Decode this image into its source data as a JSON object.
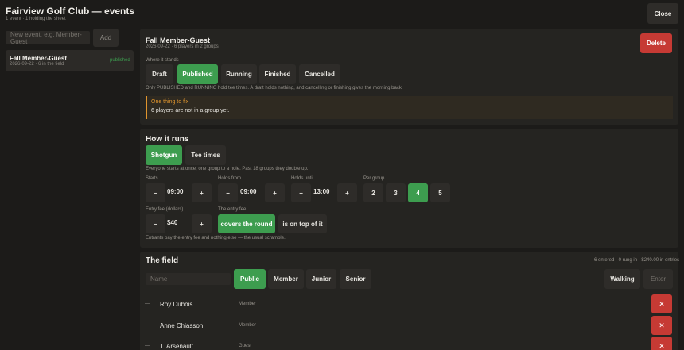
{
  "header": {
    "title": "Fairview Golf Club — events",
    "subtitle": "1 event · 1 holding the sheet",
    "close_label": "Close"
  },
  "sidebar": {
    "new_event_placeholder": "New event, e.g. Member-Guest",
    "add_label": "Add",
    "events": [
      {
        "name": "Fall Member-Guest",
        "meta": "2026-09-22 · 6 in the field",
        "status": "published"
      }
    ]
  },
  "event": {
    "name": "Fall Member-Guest",
    "meta": "2026-09-22 · 6 players in 2 groups",
    "delete_label": "Delete",
    "stands_label": "Where it stands",
    "states": [
      "Draft",
      "Published",
      "Running",
      "Finished",
      "Cancelled"
    ],
    "active_state": "Published",
    "states_note": "Only PUBLISHED and RUNNING hold tee times. A draft holds nothing, and cancelling or finishing gives the morning back.",
    "fix_title": "One thing to fix",
    "fix_text": "6 players are not in a group yet."
  },
  "runs": {
    "title": "How it runs",
    "modes": [
      "Shotgun",
      "Tee times"
    ],
    "active_mode": "Shotgun",
    "mode_note": "Everyone starts at once, one group to a hole. Past 18 groups they double up.",
    "starts_label": "Starts",
    "starts_value": "09:00",
    "holds_from_label": "Holds from",
    "holds_from_value": "09:00",
    "holds_until_label": "Holds until",
    "holds_until_value": "13:00",
    "per_group_label": "Per group",
    "per_group_options": [
      "2",
      "3",
      "4",
      "5"
    ],
    "per_group_active": "4",
    "minus": "−",
    "plus": "+",
    "fee_label": "Entry fee (dollars)",
    "fee_value": "$40",
    "fee_mode_label": "The entry fee...",
    "fee_modes": [
      "covers the round",
      "is on top of it"
    ],
    "fee_active": "covers the round",
    "fee_note": "Entrants pay the entry fee and nothing else — the usual scramble."
  },
  "field": {
    "title": "The field",
    "summary": "6 entered · 0 rung in · $240.00 in entries",
    "name_placeholder": "Name",
    "tiers": [
      "Public",
      "Member",
      "Junior",
      "Senior"
    ],
    "active_tier": "Public",
    "walking_label": "Walking",
    "enter_label": "Enter",
    "players": [
      {
        "dash": "—",
        "name": "Roy Dubois",
        "tier": "Member",
        "remove": "✕"
      },
      {
        "dash": "—",
        "name": "Anne Chiasson",
        "tier": "Member",
        "remove": "✕"
      },
      {
        "dash": "—",
        "name": "T. Arsenault",
        "tier": "Guest",
        "remove": "✕"
      }
    ]
  },
  "colors": {
    "background": "#1c1b19",
    "panel": "#252421",
    "accent_green": "#3d9d4f",
    "danger_red": "#c63a34",
    "warning_orange": "#e0952e"
  }
}
